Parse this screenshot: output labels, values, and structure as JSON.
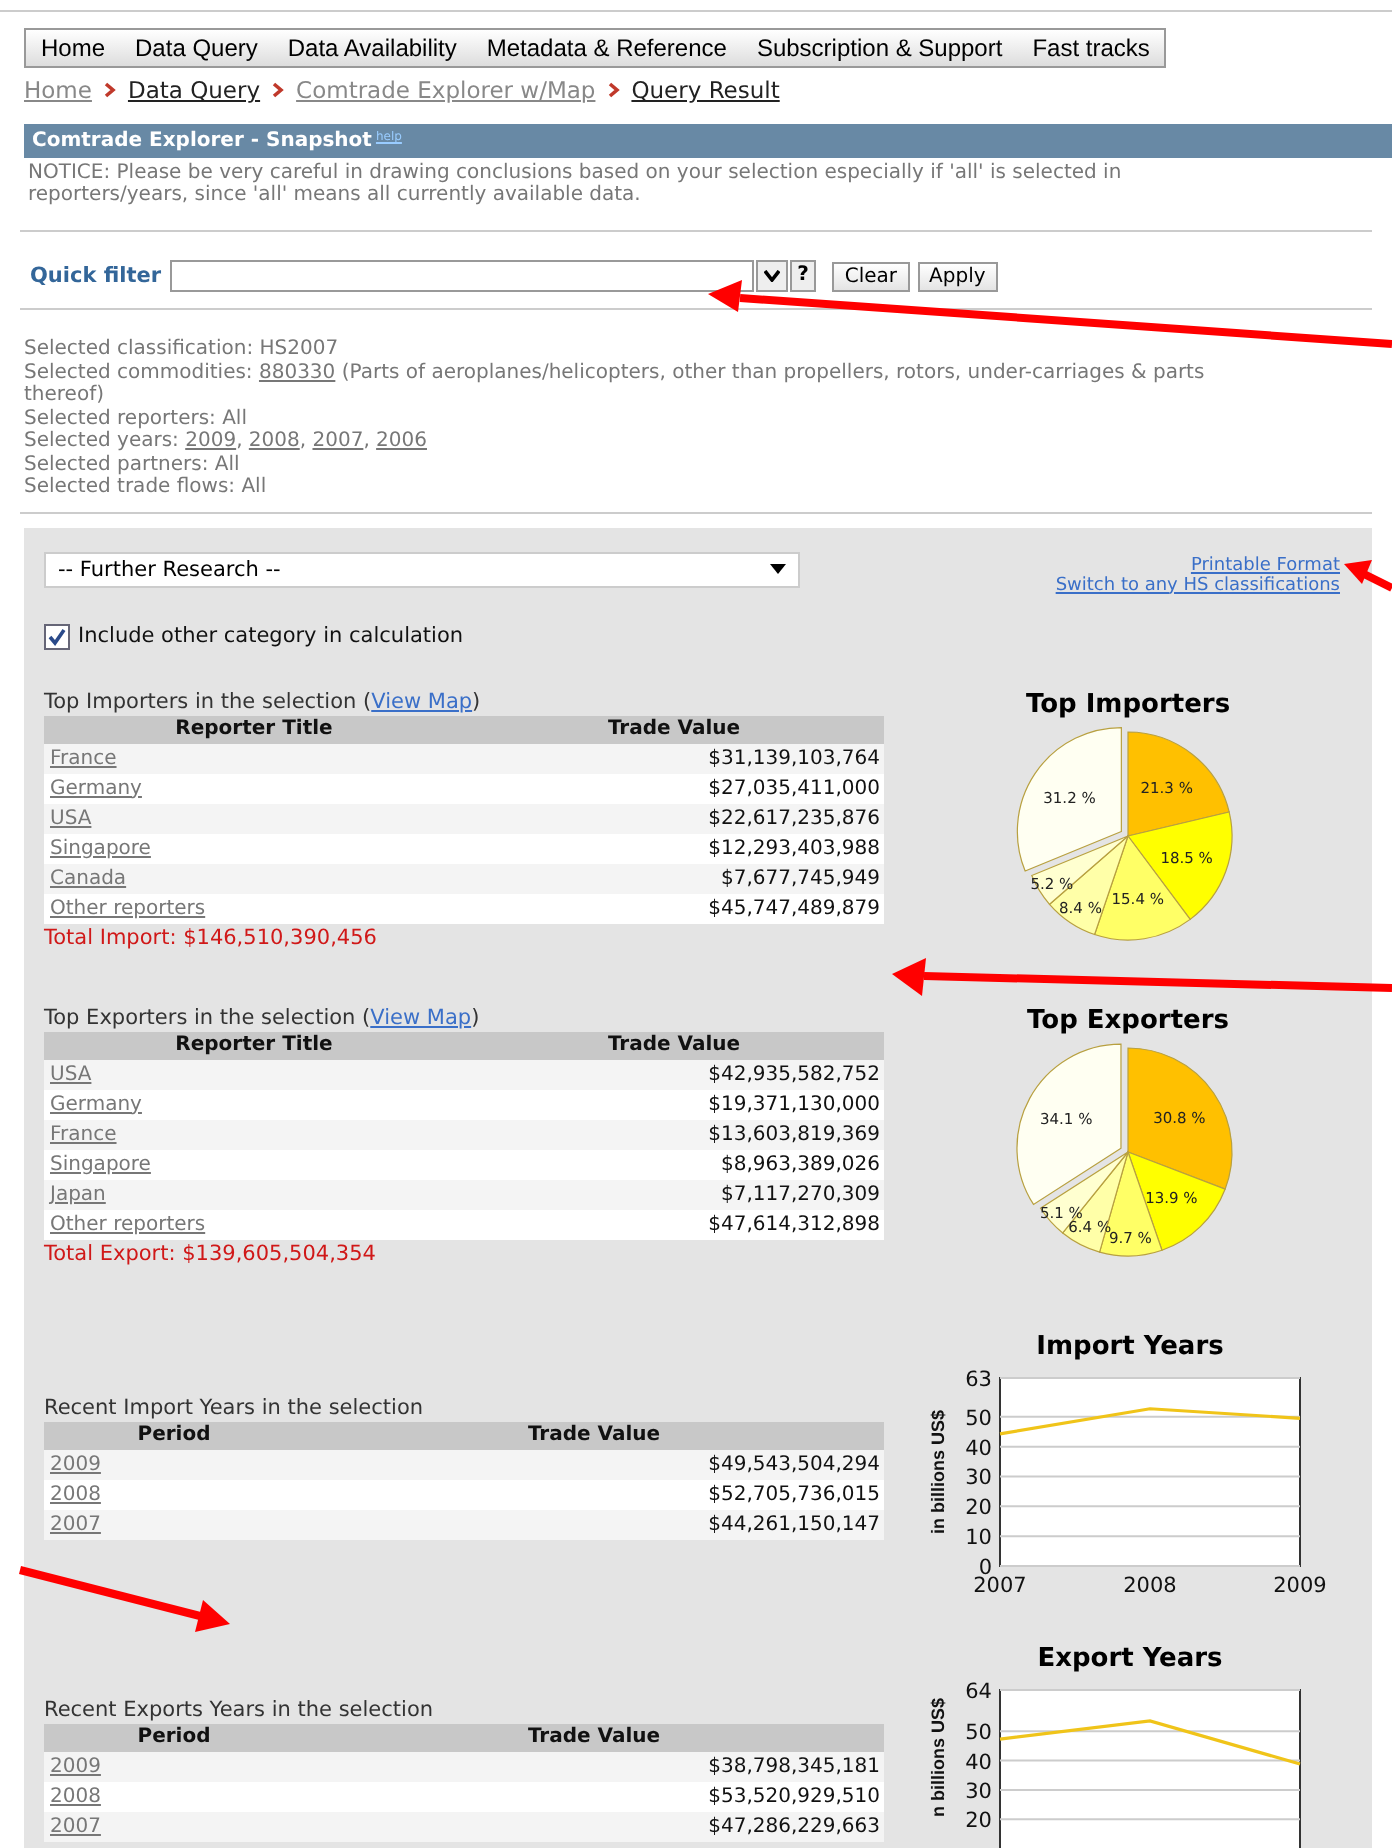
{
  "nav": {
    "items": [
      "Home",
      "Data Query",
      "Data Availability",
      "Metadata & Reference",
      "Subscription & Support",
      "Fast tracks"
    ]
  },
  "breadcrumb": [
    {
      "label": "Home",
      "visited": true
    },
    {
      "label": "Data Query",
      "visited": false
    },
    {
      "label": "Comtrade Explorer w/Map",
      "visited": true
    },
    {
      "label": "Query Result",
      "visited": false
    }
  ],
  "snapshot": {
    "title": "Comtrade Explorer - Snapshot",
    "help": "help",
    "notice": "NOTICE: Please be very careful in drawing conclusions based on your selection especially if 'all' is selected in reporters/years, since 'all' means all currently available data."
  },
  "quick_filter": {
    "label": "Quick filter",
    "help": "?",
    "buttons": [
      "Clear",
      "Apply"
    ]
  },
  "selection": [
    {
      "parts": [
        {
          "text": "Selected classification: HS2007",
          "kind": "text"
        }
      ]
    },
    {
      "parts": [
        {
          "text": "Selected commodities: ",
          "kind": "text"
        },
        {
          "text": "880330",
          "kind": "link"
        },
        {
          "text": " (Parts of aeroplanes/helicopters, other than propellers, rotors, under-carriages & parts thereof)",
          "kind": "text"
        }
      ]
    },
    {
      "parts": [
        {
          "text": "Selected reporters: All",
          "kind": "text"
        }
      ]
    },
    {
      "parts": [
        {
          "text": "Selected years: ",
          "kind": "text"
        },
        {
          "text": "2009",
          "kind": "link"
        },
        {
          "text": ", ",
          "kind": "text"
        },
        {
          "text": "2008",
          "kind": "link"
        },
        {
          "text": ", ",
          "kind": "text"
        },
        {
          "text": "2007",
          "kind": "link"
        },
        {
          "text": ", ",
          "kind": "text"
        },
        {
          "text": "2006",
          "kind": "link"
        }
      ]
    },
    {
      "parts": [
        {
          "text": "Selected partners: All",
          "kind": "text"
        }
      ]
    },
    {
      "parts": [
        {
          "text": "Selected trade flows: All",
          "kind": "text"
        }
      ]
    }
  ],
  "further_research": {
    "value": "-- Further Research --"
  },
  "links": [
    "Printable Format",
    "Switch to any HS classifications"
  ],
  "include_other": {
    "label": "Include other category in calculation",
    "checked": true
  },
  "importers": {
    "caption": "Top Importers in the selection",
    "map_link": {
      "before": "(",
      "label": "View Map",
      "after": ")"
    },
    "columns": [
      "Reporter Title",
      "Trade Value"
    ],
    "rows": [
      {
        "name": "France",
        "value": "$31,139,103,764"
      },
      {
        "name": "Germany",
        "value": "$27,035,411,000"
      },
      {
        "name": "USA",
        "value": "$22,617,235,876"
      },
      {
        "name": "Singapore",
        "value": "$12,293,403,988"
      },
      {
        "name": "Canada",
        "value": "$7,677,745,949"
      },
      {
        "name": "Other reporters",
        "value": "$45,747,489,879"
      }
    ],
    "total": "Total Import: $146,510,390,456",
    "chart_data": {
      "type": "pie",
      "title": "Top Importers",
      "values": [
        21.3,
        18.5,
        15.4,
        8.4,
        5.2,
        31.2
      ],
      "value_labels": [
        "21.3 %",
        "18.5 %",
        "15.4 %",
        "8.4 %",
        "5.2 %",
        "31.2 %"
      ]
    }
  },
  "exporters": {
    "caption": "Top Exporters in the selection",
    "map_link": {
      "before": "(",
      "label": "View Map",
      "after": ")"
    },
    "columns": [
      "Reporter Title",
      "Trade Value"
    ],
    "rows": [
      {
        "name": "USA",
        "value": "$42,935,582,752"
      },
      {
        "name": "Germany",
        "value": "$19,371,130,000"
      },
      {
        "name": "France",
        "value": "$13,603,819,369"
      },
      {
        "name": "Singapore",
        "value": "$8,963,389,026"
      },
      {
        "name": "Japan",
        "value": "$7,117,270,309"
      },
      {
        "name": "Other reporters",
        "value": "$47,614,312,898"
      }
    ],
    "total": "Total Export: $139,605,504,354",
    "chart_data": {
      "type": "pie",
      "title": "Top Exporters",
      "values": [
        30.8,
        13.9,
        9.7,
        6.4,
        5.1,
        34.1
      ],
      "value_labels": [
        "30.8 %",
        "13.9 %",
        "9.7 %",
        "6.4 %",
        "5.1 %",
        "34.1 %"
      ]
    }
  },
  "import_years": {
    "caption": "Recent Import Years in the selection",
    "columns": [
      "Period",
      "Trade Value"
    ],
    "rows": [
      {
        "name": "2009",
        "value": "$49,543,504,294"
      },
      {
        "name": "2008",
        "value": "$52,705,736,015"
      },
      {
        "name": "2007",
        "value": "$44,261,150,147"
      }
    ],
    "chart_data": {
      "type": "line",
      "title": "Import Years",
      "ylabel": "in billions US$",
      "categories": [
        "2007",
        "2008",
        "2009"
      ],
      "series": [
        {
          "color": "#f0c419",
          "values": [
            44.3,
            52.7,
            49.5
          ]
        }
      ],
      "grid": true,
      "ylim": [
        0,
        63
      ],
      "yticks": [
        0,
        10,
        20,
        30,
        40,
        50,
        63
      ]
    }
  },
  "export_years": {
    "caption": "Recent Exports Years in the selection",
    "columns": [
      "Period",
      "Trade Value"
    ],
    "rows": [
      {
        "name": "2009",
        "value": "$38,798,345,181"
      },
      {
        "name": "2008",
        "value": "$53,520,929,510"
      },
      {
        "name": "2007",
        "value": "$47,286,229,663"
      }
    ],
    "chart_data": {
      "type": "line",
      "title": "Export Years",
      "ylabel": "n billions US$",
      "series": [
        {
          "color": "#f0c419",
          "values": [
            47.3,
            53.5,
            38.8
          ]
        }
      ],
      "grid": true,
      "ylim": [
        0,
        64
      ],
      "yticks": [
        20,
        30,
        40,
        50,
        64
      ]
    }
  }
}
